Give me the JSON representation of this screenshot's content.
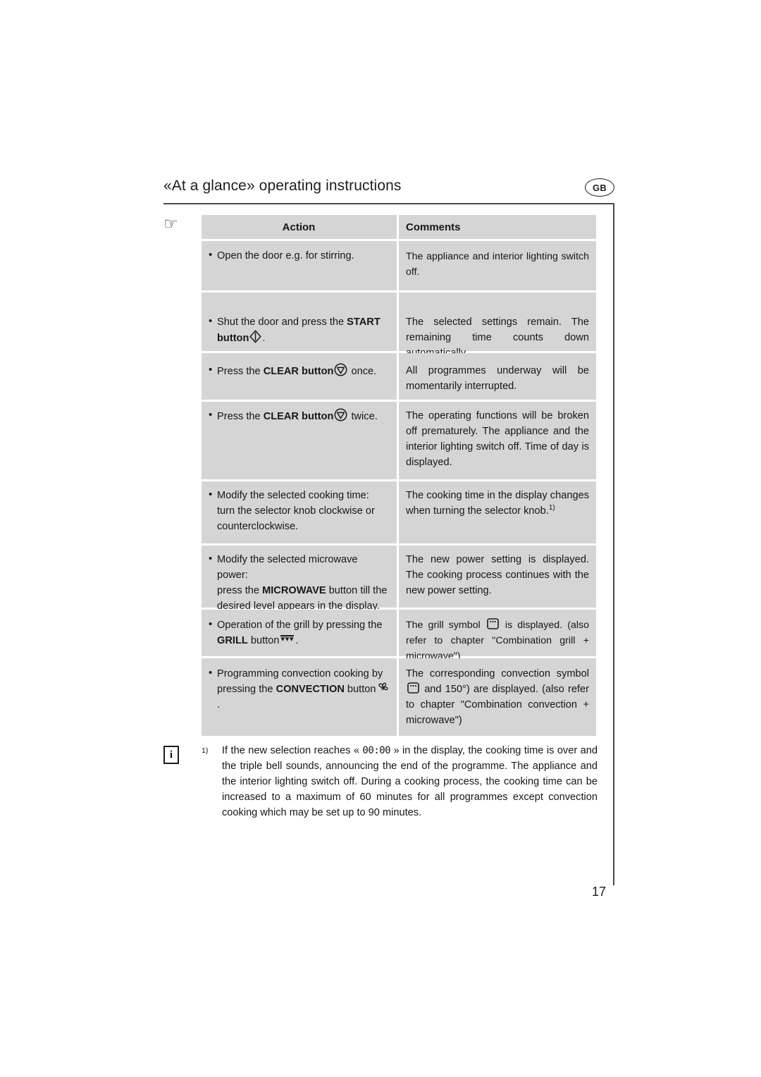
{
  "header": {
    "title": "«At a glance» operating instructions",
    "region_badge": "GB",
    "pointer_icon": "☞"
  },
  "table": {
    "columns": [
      "Action",
      "Comments"
    ],
    "rows": [
      {
        "action_pre": "Open the door e.g. for stirring.",
        "action_bold": "",
        "action_post": "",
        "action_line2": "",
        "action_line3": "",
        "comment": "The appliance and interior lighting switch off.",
        "icon": "none"
      },
      {
        "action_pre": "Shut the door and press the ",
        "action_bold": "START",
        "action_post": "",
        "action_line2_bold": "button",
        "action_line2_post": ".",
        "comment": "The selected settings remain. The remaining time counts down automatically.",
        "icon": "start-diamond-icon"
      },
      {
        "action_pre": "Press the ",
        "action_bold": "CLEAR button",
        "action_post": " once.",
        "comment": "All programmes underway will be momentarily interrupted.",
        "icon": "clear-triangle-icon"
      },
      {
        "action_pre": "Press the ",
        "action_bold": "CLEAR button",
        "action_post": " twice.",
        "comment": "The operating functions will be broken off prematurely. The appliance and the interior lighting switch off. Time of day is displayed.",
        "icon": "clear-triangle-icon"
      },
      {
        "action_pre": "Modify the selected cooking time:",
        "action_line2": "turn the selector knob clockwise or",
        "action_line3": "counterclockwise.",
        "comment": "The cooking time in the display changes when turning the selector knob.",
        "comment_footnote_ref": "1)",
        "icon": "none"
      },
      {
        "action_pre": "Modify the selected microwave power:",
        "action_line2_pre": "press the ",
        "action_line2_bold": "MICROWAVE",
        "action_line2_post": " button till the",
        "action_line3": "desired level appears in the display.",
        "comment": "The new power setting is displayed. The cooking process continues with the new power setting.",
        "icon": "none"
      },
      {
        "action_pre": "Operation of the grill by pressing the",
        "action_line2_bold": "GRILL",
        "action_line2_post": " button",
        "action_line2_end": ".",
        "comment_pre": "The grill symbol ",
        "comment_post": " is displayed. (also refer to chapter \"Combination grill + microwave\")",
        "icon": "grill-triangles-icon"
      },
      {
        "action_pre": "Programming convection cooking by",
        "action_line2_pre": "pressing the ",
        "action_line2_bold": "CONVECTION",
        "action_line2_post": " button",
        "action_line2_end": ".",
        "comment_pre": "The corresponding convection symbol ",
        "comment_post": " and 150°) are displayed. (also refer to chapter \"Combination convection + microwave\")",
        "icon": "fan-icon"
      }
    ]
  },
  "footnote": {
    "info_icon_letter": "i",
    "marker": "1)",
    "text_part1": "If the new selection reaches « ",
    "lcd_value": "00:00",
    "text_part2": " » in the display, the cooking time is over and the triple bell sounds, announcing the end of the programme. The appliance and the interior lighting switch off. During a cooking process, the cooking time can be increased to a maximum of 60 minutes for all programmes except convection cooking which may be set up to 90 minutes."
  },
  "page_number": "17"
}
